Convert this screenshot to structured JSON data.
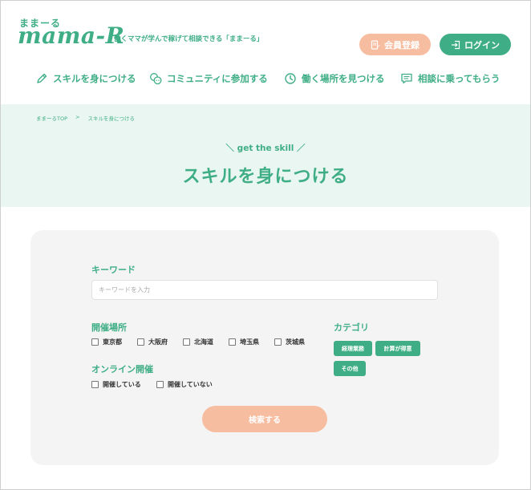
{
  "header": {
    "logo_small": "ままーる",
    "logo_main": "mama-R",
    "tagline": "働くママが学んで稼げて相談できる「ままーる」",
    "register_label": "会員登録",
    "login_label": "ログイン"
  },
  "nav": {
    "items": [
      {
        "label": "スキルを身につける",
        "icon": "pencil-icon"
      },
      {
        "label": "コミュニティに参加する",
        "icon": "chat-bubbles-icon"
      },
      {
        "label": "働く場所を見つける",
        "icon": "clock-icon"
      },
      {
        "label": "相談に乗ってもらう",
        "icon": "message-icon"
      }
    ]
  },
  "breadcrumb": {
    "home": "ままーるTOP",
    "separator": ">",
    "current": "スキルを身につける"
  },
  "hero": {
    "subtitle": "＼ get the skill ／",
    "title": "スキルを身につける"
  },
  "search": {
    "keyword_label": "キーワード",
    "keyword_placeholder": "キーワードを入力",
    "location_label": "開催場所",
    "locations": [
      "東京都",
      "大阪府",
      "北海道",
      "埼玉県",
      "茨城県"
    ],
    "online_label": "オンライン開催",
    "online_options": [
      "開催している",
      "開催していない"
    ],
    "category_label": "カテゴリ",
    "categories": [
      "経理業務",
      "計算が得意",
      "その他"
    ],
    "submit_label": "検索する"
  },
  "colors": {
    "brand_green": "#3fae86",
    "accent_peach": "#f7bda0",
    "hero_bg": "#eaf6f1",
    "card_bg": "#f4f4f4"
  }
}
